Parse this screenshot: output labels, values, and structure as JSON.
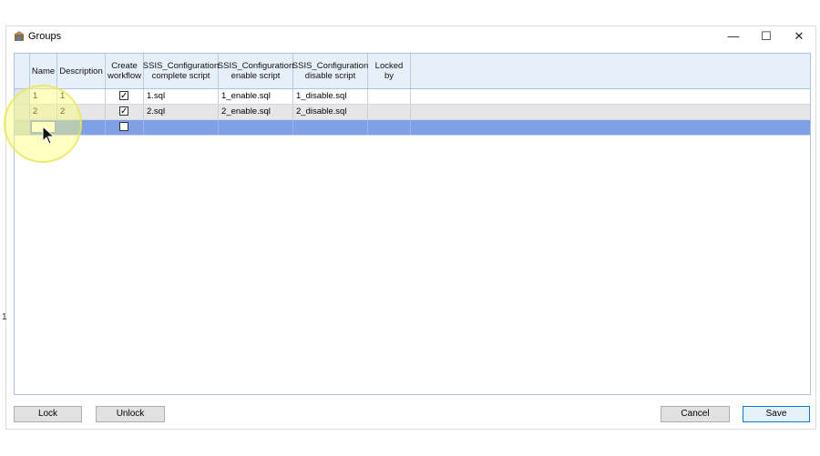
{
  "window": {
    "title": "Groups",
    "minimize": "—",
    "maximize": "☐",
    "close": "✕"
  },
  "grid": {
    "columns": [
      "Name",
      "Description",
      "Create workflow",
      "SSIS_Configuration complete script",
      "SSIS_Configuration enable script",
      "SSIS_Configuration disable script",
      "Locked by"
    ],
    "rows": [
      {
        "name": "1",
        "description": "1",
        "create_workflow": true,
        "complete_script": "1.sql",
        "enable_script": "1_enable.sql",
        "disable_script": "1_disable.sql",
        "locked_by": ""
      },
      {
        "name": "2",
        "description": "2",
        "create_workflow": true,
        "complete_script": "2.sql",
        "enable_script": "2_enable.sql",
        "disable_script": "2_disable.sql",
        "locked_by": ""
      },
      {
        "name": "",
        "description": "",
        "create_workflow": false,
        "complete_script": "",
        "enable_script": "",
        "disable_script": "",
        "locked_by": ""
      }
    ]
  },
  "buttons": {
    "lock": "Lock",
    "unlock": "Unlock",
    "cancel": "Cancel",
    "save": "Save"
  },
  "colors": {
    "selected_row": "#7f9fe7",
    "header_bg": "#e7eff9",
    "highlight": "#ffff78"
  },
  "stray_text": "1"
}
